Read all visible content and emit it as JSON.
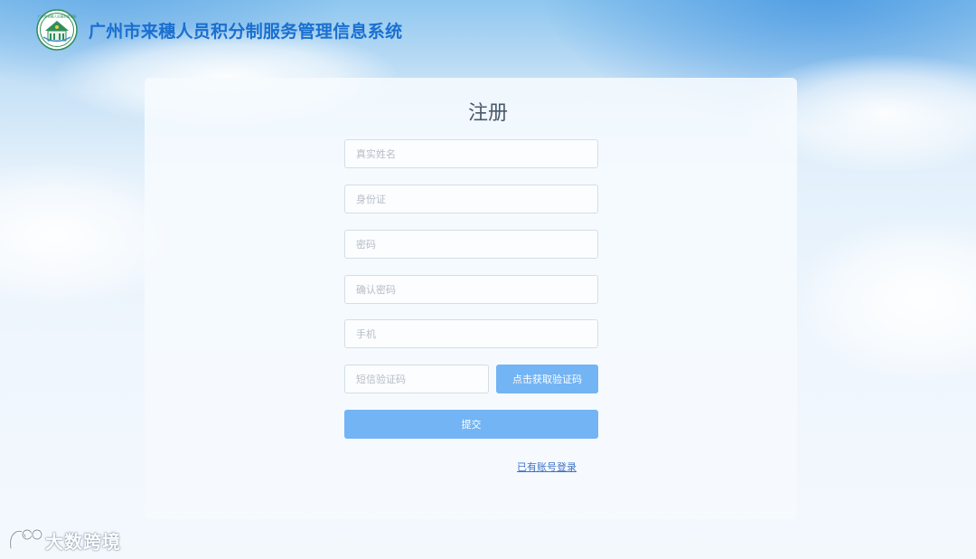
{
  "header": {
    "title": "广州市来穗人员积分制服务管理信息系统",
    "logo_icon": "government-emblem-logo",
    "logo_text": "广州市来穗人员服务管理局"
  },
  "form": {
    "title": "注册",
    "fields": {
      "real_name": {
        "placeholder": "真实姓名",
        "value": ""
      },
      "id_card": {
        "placeholder": "身份证",
        "value": ""
      },
      "password": {
        "placeholder": "密码",
        "value": ""
      },
      "confirm_password": {
        "placeholder": "确认密码",
        "value": ""
      },
      "phone": {
        "placeholder": "手机",
        "value": ""
      },
      "sms_code": {
        "placeholder": "短信验证码",
        "value": ""
      }
    },
    "get_code_label": "点击获取验证码",
    "submit_label": "提交",
    "login_link": "已有账号登录"
  },
  "watermark": {
    "text": "大数跨境",
    "icon": "brand-logo-icon"
  },
  "colors": {
    "title_blue": "#1a6fd0",
    "button_blue": "#72b4f4",
    "link_blue": "#3f72c8",
    "card_bg": "#f6fafe"
  }
}
